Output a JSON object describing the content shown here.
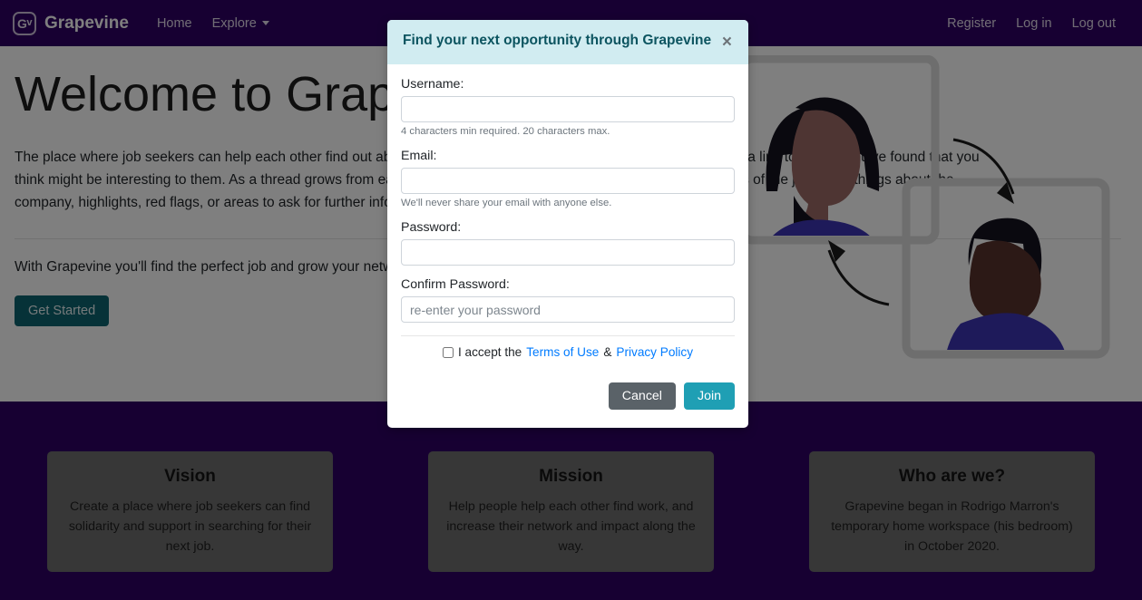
{
  "navbar": {
    "logo_text_g": "G",
    "logo_text_v": "v",
    "brand": "Grapevine",
    "links": [
      {
        "label": "Home",
        "name": "nav-link-home"
      },
      {
        "label": "Explore",
        "name": "nav-link-explore"
      }
    ],
    "right_links": [
      {
        "label": "Register",
        "name": "nav-link-register"
      },
      {
        "label": "Log in",
        "name": "nav-link-login"
      },
      {
        "label": "Log out",
        "name": "nav-link-logout"
      }
    ]
  },
  "hero": {
    "title": "Welcome to Grapevine",
    "paragraph": "The place where job seekers can help each other find out about new opportunities. Send your cluster a message with a link to the job you've found that you think might be interesting to them. As a thread grows from each message you and your cluster can talk about specifics of the job, good things about the company, highlights, red flags, or areas to ask for further information.",
    "subtext": "With Grapevine you'll find the perfect job and grow your network at the same time.",
    "cta_label": "Get Started"
  },
  "cards": [
    {
      "title": "Vision",
      "body": "Create a place where job seekers can find solidarity and support in searching for their next job."
    },
    {
      "title": "Mission",
      "body": "Help people help each other find work, and increase their network and impact along the way."
    },
    {
      "title": "Who are we?",
      "body": "Grapevine began in Rodrigo Marron's temporary home workspace (his bedroom) in October 2020."
    }
  ],
  "modal": {
    "title": "Find your next opportunity through Grapevine",
    "close_label": "×",
    "fields": {
      "username": {
        "label": "Username:",
        "value": "",
        "placeholder": "",
        "help": "4 characters min required. 20 characters max."
      },
      "email": {
        "label": "Email:",
        "value": "",
        "placeholder": "",
        "help": "We'll never share your email with anyone else."
      },
      "password": {
        "label": "Password:",
        "value": "",
        "placeholder": ""
      },
      "confirm_password": {
        "label": "Confirm Password:",
        "value": "",
        "placeholder": "re-enter your password"
      }
    },
    "terms": {
      "accept_text": "I accept the",
      "terms_link": "Terms of Use",
      "separator": "&",
      "privacy_link": "Privacy Policy",
      "checked": false
    },
    "buttons": {
      "cancel": "Cancel",
      "join": "Join"
    }
  },
  "colors": {
    "brand_purple": "#2e0064",
    "modal_header_bg": "#d1ecf1",
    "modal_header_text": "#0c5460",
    "join_teal": "#1f9fb4",
    "cancel_gray": "#5a6268",
    "cta_teal": "#0d6470",
    "link_blue": "#007bff"
  }
}
